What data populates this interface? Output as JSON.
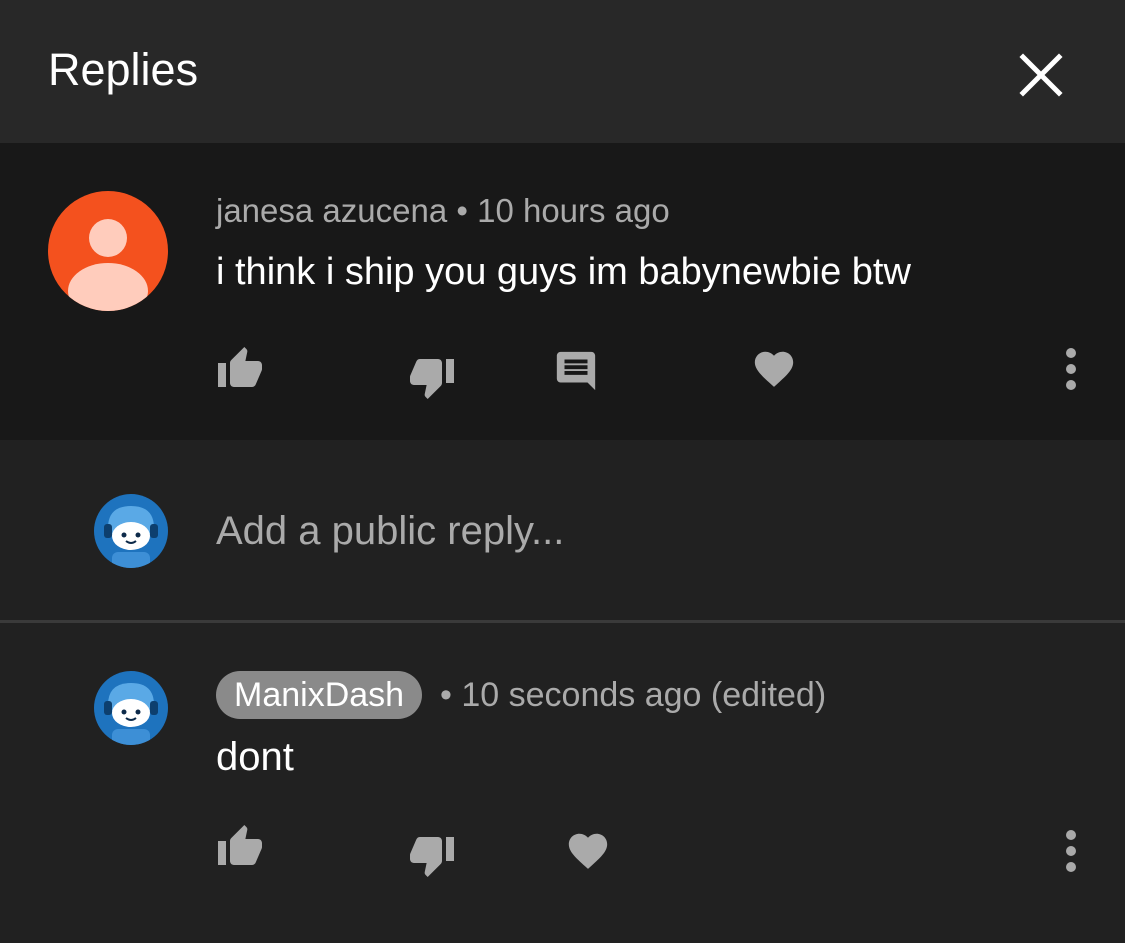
{
  "header": {
    "title": "Replies",
    "close_icon": "close-icon"
  },
  "parent_comment": {
    "author": "janesa azucena",
    "separator": "•",
    "time": "10 hours ago",
    "text": "i think i ship you guys im babynewbie btw",
    "avatar_color": "#f4511e",
    "actions": [
      "thumbs-up-icon",
      "thumbs-down-icon",
      "reply-icon",
      "heart-icon",
      "more-vert-icon"
    ]
  },
  "reply_box": {
    "placeholder": "Add a public reply..."
  },
  "reply_comment": {
    "author": "ManixDash",
    "separator": "•",
    "time": "10 seconds ago (edited)",
    "text": "dont",
    "actions": [
      "thumbs-up-icon",
      "thumbs-down-icon",
      "heart-icon",
      "more-vert-icon"
    ]
  },
  "colors": {
    "background": "#212121",
    "header": "#282828",
    "highlight": "#181818",
    "secondary_text": "#aaaaaa",
    "icon": "#aaaaaa",
    "user_avatar_blue": "#1e73be"
  }
}
